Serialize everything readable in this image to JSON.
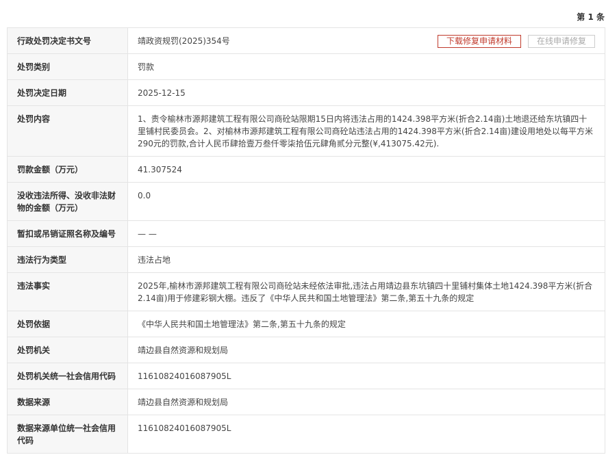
{
  "page_count": "第 1 条",
  "actions": {
    "download_label": "下载修复申请材料",
    "online_label": "在线申请修复"
  },
  "rows": [
    {
      "label": "行政处罚决定书文号",
      "value": "靖政资规罚(2025)354号"
    },
    {
      "label": "处罚类别",
      "value": "罚款"
    },
    {
      "label": "处罚决定日期",
      "value": "2025-12-15"
    },
    {
      "label": "处罚内容",
      "value": "1、责令榆林市源邦建筑工程有限公司商砼站限期15日内将违法占用的1424.398平方米(折合2.14亩)土地退还给东坑镇四十里铺村民委员会。2、对榆林市源邦建筑工程有限公司商砼站违法占用的1424.398平方米(折合2.14亩)建设用地处以每平方米290元的罚款,合计人民币肆拾壹万叁仟零柒拾伍元肆角贰分元整(¥,413075.42元)."
    },
    {
      "label": "罚款金额（万元）",
      "value": "41.307524"
    },
    {
      "label": "没收违法所得、没收非法财物的金额（万元）",
      "value": "0.0"
    },
    {
      "label": "暂扣或吊销证照名称及编号",
      "value": "— —"
    },
    {
      "label": "违法行为类型",
      "value": "违法占地"
    },
    {
      "label": "违法事实",
      "value": "2025年,榆林市源邦建筑工程有限公司商砼站未经依法审批,违法占用靖边县东坑镇四十里铺村集体土地1424.398平方米(折合2.14亩)用于修建彩钢大棚。违反了《中华人民共和国土地管理法》第二条,第五十九条的规定"
    },
    {
      "label": "处罚依据",
      "value": "《中华人民共和国土地管理法》第二条,第五十九条的规定"
    },
    {
      "label": "处罚机关",
      "value": "靖边县自然资源和规划局"
    },
    {
      "label": "处罚机关统一社会信用代码",
      "value": "11610824016087905L"
    },
    {
      "label": "数据来源",
      "value": "靖边县自然资源和规划局"
    },
    {
      "label": "数据来源单位统一社会信用代码",
      "value": "11610824016087905L"
    }
  ]
}
